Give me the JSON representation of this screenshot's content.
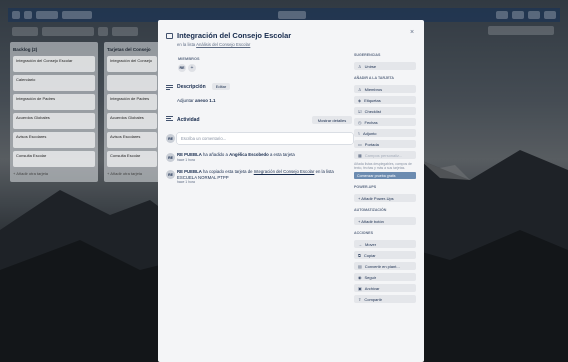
{
  "app": {
    "board_name": "CONSEJO ESCOLAR",
    "colors": {
      "accent": "#0079bf",
      "modal_bg": "#f4f5f7",
      "button_bg": "#e4e6ea",
      "text": "#172b4d",
      "muted": "#5e6c84"
    }
  },
  "lists": [
    {
      "title": "Backlog (2)",
      "cards": [
        "Integración del Consejo Escolar",
        "Calendario",
        "Integración de Padres",
        "Acuerdos Globales",
        "Avisos Escolares",
        "Consulta Escolar"
      ],
      "add_label": "+ Añadir otra tarjeta"
    },
    {
      "title": "Tarjetas del Consejo",
      "cards": [
        "Integración del Consejo",
        "",
        "Integración de Padres",
        "Acuerdos Globales",
        "Avisos Escolares",
        "Consulta Escolar"
      ],
      "add_label": "+ Añadir otra tarjeta"
    }
  ],
  "card_modal": {
    "title": "Integración del Consejo Escolar",
    "in_list_prefix": "en la lista",
    "in_list_name": "Análisis del Consejo Escolar",
    "members_label": "MIEMBROS",
    "member_initials": "RE",
    "add_member": "+",
    "description_label": "Descripción",
    "edit_label": "Editar",
    "description_prefix": "Adjuntar",
    "description_value": "anexo 1.1",
    "activity_label": "Actividad",
    "show_details_label": "Mostrar detalles",
    "comment_placeholder": "Escriba un comentario...",
    "close_icon": "×",
    "activity": [
      {
        "initials": "RE",
        "user": "RE PUEBLA",
        "text": "ha añadido a",
        "target": "Angélica Escobedo",
        "suffix": "a esta tarjeta",
        "time": "hace 1 hora"
      },
      {
        "initials": "RE",
        "user": "RE PUEBLA",
        "text": "ha copiado esta tarjeta de",
        "target": "Integración del Consejo Escolar",
        "suffix": "en la lista ESCUELA NORMAL PTPP",
        "time": "hace 1 hora"
      }
    ]
  },
  "sidebar": {
    "suggested_label": "SUGERENCIAS",
    "join_label": "Unirse",
    "add_label": "AÑADIR A LA TARJETA",
    "add_items": [
      {
        "icon": "person-icon",
        "glyph": "♙",
        "label": "Miembros"
      },
      {
        "icon": "tag-icon",
        "glyph": "◈",
        "label": "Etiquetas"
      },
      {
        "icon": "checklist-icon",
        "glyph": "☑",
        "label": "Checklist"
      },
      {
        "icon": "clock-icon",
        "glyph": "◷",
        "label": "Fechas"
      },
      {
        "icon": "paperclip-icon",
        "glyph": "⌇",
        "label": "Adjunto"
      },
      {
        "icon": "cover-icon",
        "glyph": "▭",
        "label": "Portada"
      }
    ],
    "custom_fields_disabled": "Campos personaliz...",
    "custom_fields_hint": "Añada listas desplegables, campos de texto, fechas y más a sus tarjetas.",
    "custom_fields_link": "Comenzar prueba gratis",
    "powerups_label": "POWER-UPS",
    "powerups_add": "+ Añadir Power-Ups",
    "automation_label": "AUTOMATIZACIÓN",
    "automation_add": "+ Añadir botón",
    "actions_label": "ACCIONES",
    "action_items": [
      {
        "icon": "arrow-icon",
        "glyph": "→",
        "label": "Mover"
      },
      {
        "icon": "copy-icon",
        "glyph": "⧉",
        "label": "Copiar"
      },
      {
        "icon": "template-icon",
        "glyph": "▤",
        "label": "Convertir en plant..."
      },
      {
        "icon": "eye-icon",
        "glyph": "◉",
        "label": "Seguir"
      },
      {
        "icon": "archive-icon",
        "glyph": "▣",
        "label": "Archivar"
      },
      {
        "icon": "share-icon",
        "glyph": "⇪",
        "label": "Compartir"
      }
    ]
  }
}
